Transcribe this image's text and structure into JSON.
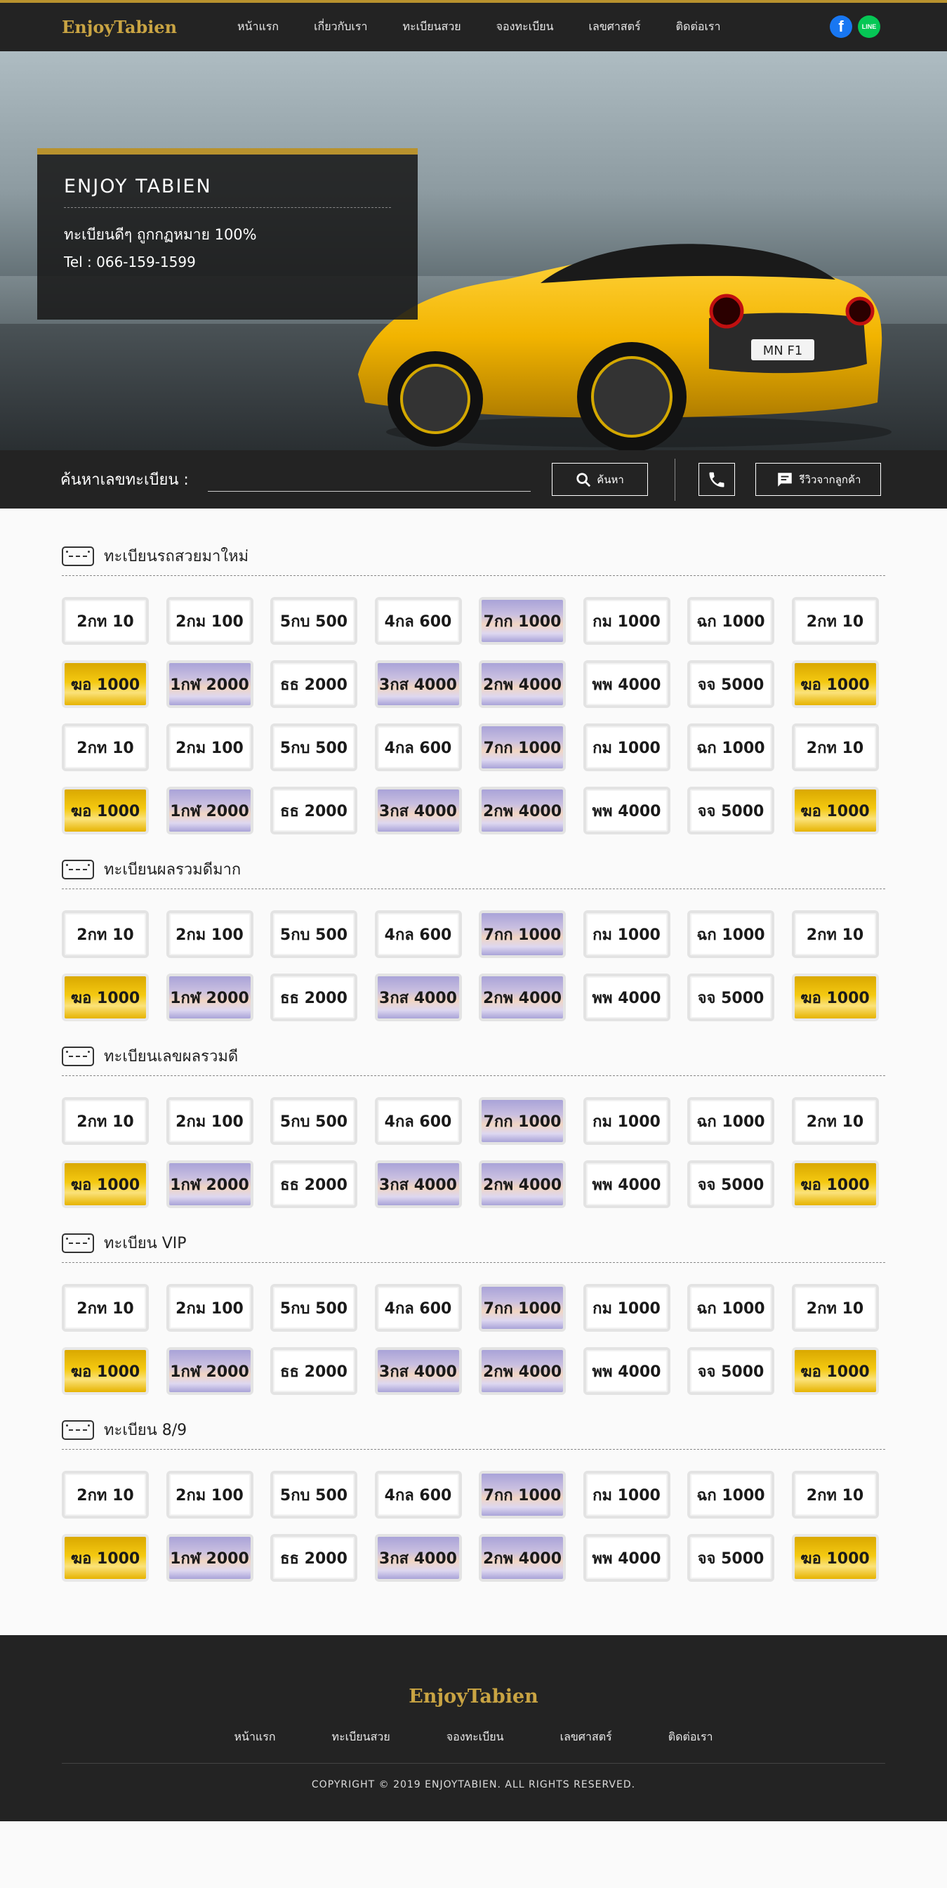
{
  "brand": "EnjoyTabien",
  "nav": [
    "หน้าแรก",
    "เกี่ยวกับเรา",
    "ทะเบียนสวย",
    "จองทะเบียน",
    "เลขศาสตร์",
    "ติดต่อเรา"
  ],
  "social": {
    "facebook": "f",
    "line": "LINE"
  },
  "hero": {
    "title": "ENJOY TABIEN",
    "tagline": "ทะเบียนดีๆ ถูกกฏหมาย 100%",
    "tel": "Tel : 066-159-1599",
    "car_plate": "MN F1"
  },
  "search": {
    "label": "ค้นหาเลขทะเบียน :",
    "placeholder": "",
    "button": "ค้นหา",
    "review_button": "รีวิวจากลูกค้า"
  },
  "sections": [
    {
      "title": "ทะเบียนรถสวยมาใหม่",
      "plates": [
        {
          "text": "2กท 10",
          "style": "white"
        },
        {
          "text": "2กม 100",
          "style": "white"
        },
        {
          "text": "5กบ 500",
          "style": "white"
        },
        {
          "text": "4กล 600",
          "style": "white"
        },
        {
          "text": "7กก 1000",
          "style": "purple"
        },
        {
          "text": "กม 1000",
          "style": "white"
        },
        {
          "text": "ฉก 1000",
          "style": "white"
        },
        {
          "text": "2กท 10",
          "style": "white"
        },
        {
          "text": "ฆอ 1000",
          "style": "gold"
        },
        {
          "text": "1กฬ 2000",
          "style": "purple"
        },
        {
          "text": "ธธ 2000",
          "style": "white"
        },
        {
          "text": "3กส 4000",
          "style": "purple"
        },
        {
          "text": "2กพ 4000",
          "style": "purple"
        },
        {
          "text": "พพ 4000",
          "style": "white"
        },
        {
          "text": "จจ 5000",
          "style": "white"
        },
        {
          "text": "ฆอ 1000",
          "style": "gold"
        },
        {
          "text": "2กท 10",
          "style": "white"
        },
        {
          "text": "2กม 100",
          "style": "white"
        },
        {
          "text": "5กบ 500",
          "style": "white"
        },
        {
          "text": "4กล 600",
          "style": "white"
        },
        {
          "text": "7กก 1000",
          "style": "purple"
        },
        {
          "text": "กม 1000",
          "style": "white"
        },
        {
          "text": "ฉก 1000",
          "style": "white"
        },
        {
          "text": "2กท 10",
          "style": "white"
        },
        {
          "text": "ฆอ 1000",
          "style": "gold"
        },
        {
          "text": "1กฬ 2000",
          "style": "purple"
        },
        {
          "text": "ธธ 2000",
          "style": "white"
        },
        {
          "text": "3กส 4000",
          "style": "purple"
        },
        {
          "text": "2กพ 4000",
          "style": "purple"
        },
        {
          "text": "พพ 4000",
          "style": "white"
        },
        {
          "text": "จจ 5000",
          "style": "white"
        },
        {
          "text": "ฆอ 1000",
          "style": "gold"
        }
      ]
    },
    {
      "title": "ทะเบียนผลรวมดีมาก",
      "plates": [
        {
          "text": "2กท 10",
          "style": "white"
        },
        {
          "text": "2กม 100",
          "style": "white"
        },
        {
          "text": "5กบ 500",
          "style": "white"
        },
        {
          "text": "4กล 600",
          "style": "white"
        },
        {
          "text": "7กก 1000",
          "style": "purple"
        },
        {
          "text": "กม 1000",
          "style": "white"
        },
        {
          "text": "ฉก 1000",
          "style": "white"
        },
        {
          "text": "2กท 10",
          "style": "white"
        },
        {
          "text": "ฆอ 1000",
          "style": "gold"
        },
        {
          "text": "1กฬ 2000",
          "style": "purple"
        },
        {
          "text": "ธธ 2000",
          "style": "white"
        },
        {
          "text": "3กส 4000",
          "style": "purple"
        },
        {
          "text": "2กพ 4000",
          "style": "purple"
        },
        {
          "text": "พพ 4000",
          "style": "white"
        },
        {
          "text": "จจ 5000",
          "style": "white"
        },
        {
          "text": "ฆอ 1000",
          "style": "gold"
        }
      ]
    },
    {
      "title": "ทะเบียนเลขผลรวมดี",
      "plates": [
        {
          "text": "2กท 10",
          "style": "white"
        },
        {
          "text": "2กม 100",
          "style": "white"
        },
        {
          "text": "5กบ 500",
          "style": "white"
        },
        {
          "text": "4กล 600",
          "style": "white"
        },
        {
          "text": "7กก 1000",
          "style": "purple"
        },
        {
          "text": "กม 1000",
          "style": "white"
        },
        {
          "text": "ฉก 1000",
          "style": "white"
        },
        {
          "text": "2กท 10",
          "style": "white"
        },
        {
          "text": "ฆอ 1000",
          "style": "gold"
        },
        {
          "text": "1กฬ 2000",
          "style": "purple"
        },
        {
          "text": "ธธ 2000",
          "style": "white"
        },
        {
          "text": "3กส 4000",
          "style": "purple"
        },
        {
          "text": "2กพ 4000",
          "style": "purple"
        },
        {
          "text": "พพ 4000",
          "style": "white"
        },
        {
          "text": "จจ 5000",
          "style": "white"
        },
        {
          "text": "ฆอ 1000",
          "style": "gold"
        }
      ]
    },
    {
      "title": "ทะเบียน VIP",
      "plates": [
        {
          "text": "2กท 10",
          "style": "white"
        },
        {
          "text": "2กม 100",
          "style": "white"
        },
        {
          "text": "5กบ 500",
          "style": "white"
        },
        {
          "text": "4กล 600",
          "style": "white"
        },
        {
          "text": "7กก 1000",
          "style": "purple"
        },
        {
          "text": "กม 1000",
          "style": "white"
        },
        {
          "text": "ฉก 1000",
          "style": "white"
        },
        {
          "text": "2กท 10",
          "style": "white"
        },
        {
          "text": "ฆอ 1000",
          "style": "gold"
        },
        {
          "text": "1กฬ 2000",
          "style": "purple"
        },
        {
          "text": "ธธ 2000",
          "style": "white"
        },
        {
          "text": "3กส 4000",
          "style": "purple"
        },
        {
          "text": "2กพ 4000",
          "style": "purple"
        },
        {
          "text": "พพ 4000",
          "style": "white"
        },
        {
          "text": "จจ 5000",
          "style": "white"
        },
        {
          "text": "ฆอ 1000",
          "style": "gold"
        }
      ]
    },
    {
      "title": "ทะเบียน 8/9",
      "plates": [
        {
          "text": "2กท 10",
          "style": "white"
        },
        {
          "text": "2กม 100",
          "style": "white"
        },
        {
          "text": "5กบ 500",
          "style": "white"
        },
        {
          "text": "4กล 600",
          "style": "white"
        },
        {
          "text": "7กก 1000",
          "style": "purple"
        },
        {
          "text": "กม 1000",
          "style": "white"
        },
        {
          "text": "ฉก 1000",
          "style": "white"
        },
        {
          "text": "2กท 10",
          "style": "white"
        },
        {
          "text": "ฆอ 1000",
          "style": "gold"
        },
        {
          "text": "1กฬ 2000",
          "style": "purple"
        },
        {
          "text": "ธธ 2000",
          "style": "white"
        },
        {
          "text": "3กส 4000",
          "style": "purple"
        },
        {
          "text": "2กพ 4000",
          "style": "purple"
        },
        {
          "text": "พพ 4000",
          "style": "white"
        },
        {
          "text": "จจ 5000",
          "style": "white"
        },
        {
          "text": "ฆอ 1000",
          "style": "gold"
        }
      ]
    }
  ],
  "footer": {
    "brand": "EnjoyTabien",
    "menu": [
      "หน้าแรก",
      "ทะเบียนสวย",
      "จองทะเบียน",
      "เลขศาสตร์",
      "ติดต่อเรา"
    ],
    "copyright": "COPYRIGHT © 2019 ENJOYTABIEN. ALL RIGHTS RESERVED."
  },
  "colors": {
    "accent": "#b8922e",
    "dark": "#232323",
    "brand": "#c9a443"
  }
}
